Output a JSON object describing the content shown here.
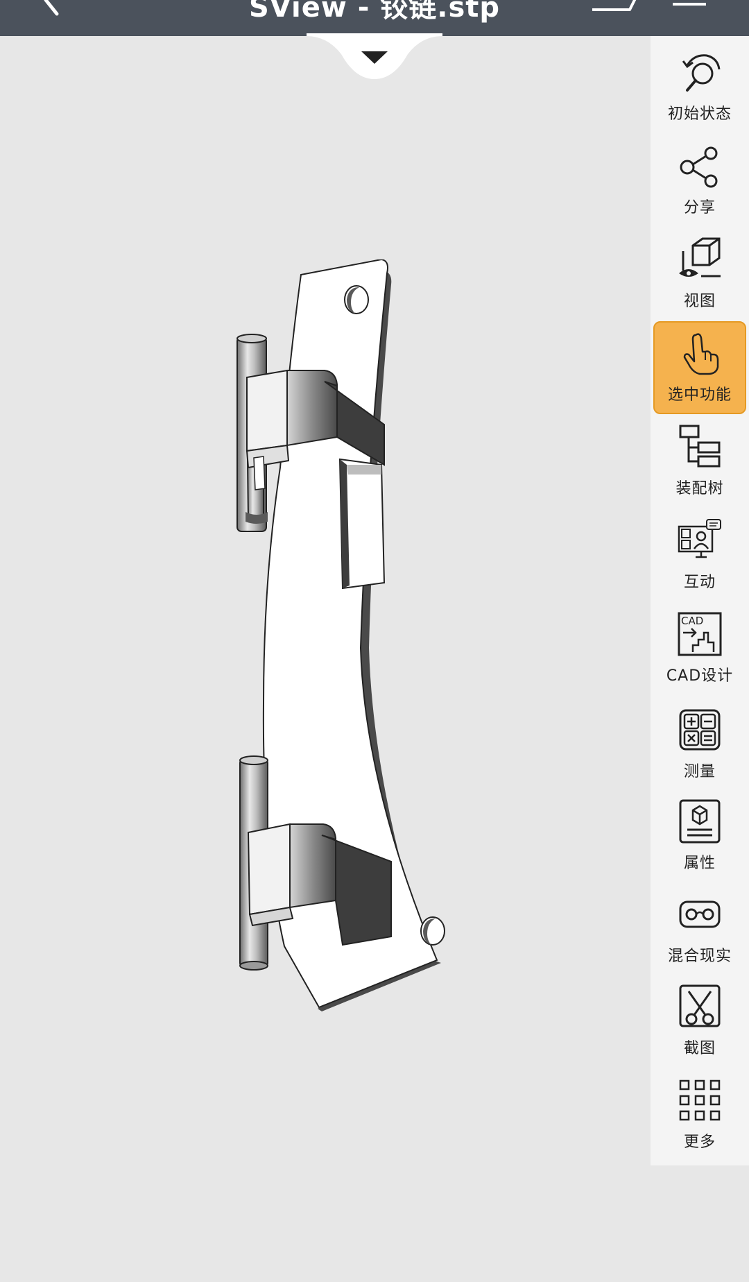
{
  "app": {
    "title": "SView - 铰链.stp"
  },
  "toolbar": {
    "items": [
      {
        "label": "初始状态",
        "icon": "reset-view-icon"
      },
      {
        "label": "分享",
        "icon": "share-icon"
      },
      {
        "label": "视图",
        "icon": "view-cube-icon"
      },
      {
        "label": "选中功能",
        "icon": "hand-pointer-icon",
        "active": true
      },
      {
        "label": "装配树",
        "icon": "assembly-tree-icon"
      },
      {
        "label": "互动",
        "icon": "interaction-icon"
      },
      {
        "label": "CAD设计",
        "icon": "cad-design-icon",
        "badge": "CAD"
      },
      {
        "label": "测量",
        "icon": "calculator-icon"
      },
      {
        "label": "属性",
        "icon": "properties-icon"
      },
      {
        "label": "混合现实",
        "icon": "vr-headset-icon"
      },
      {
        "label": "截图",
        "icon": "scissors-icon"
      },
      {
        "label": "更多",
        "icon": "grid-more-icon"
      }
    ]
  },
  "colors": {
    "topbar": "#4b525c",
    "viewport": "#e7e7e7",
    "toolbar": "#f4f4f4",
    "active_tool": "#f5b24e"
  }
}
